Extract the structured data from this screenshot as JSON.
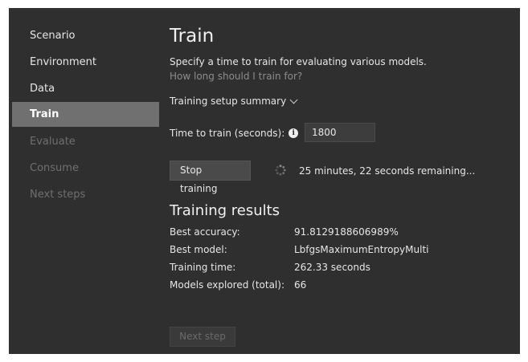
{
  "sidebar": {
    "items": [
      {
        "label": "Scenario",
        "state": "normal"
      },
      {
        "label": "Environment",
        "state": "normal"
      },
      {
        "label": "Data",
        "state": "normal"
      },
      {
        "label": "Train",
        "state": "selected"
      },
      {
        "label": "Evaluate",
        "state": "disabled"
      },
      {
        "label": "Consume",
        "state": "disabled"
      },
      {
        "label": "Next steps",
        "state": "disabled"
      }
    ]
  },
  "main": {
    "title": "Train",
    "description": "Specify a time to train for evaluating various models.",
    "help_link": "How long should I train for?",
    "summary_toggle": "Training setup summary",
    "time_to_train_label": "Time to train (seconds):",
    "time_to_train_value": "1800",
    "stop_button": "Stop training",
    "remaining_text": "25 minutes, 22 seconds remaining...",
    "results_title": "Training results",
    "results": [
      {
        "label": "Best accuracy:",
        "value": "91.8129188606989%"
      },
      {
        "label": "Best model:",
        "value": "LbfgsMaximumEntropyMulti"
      },
      {
        "label": "Training time:",
        "value": "262.33 seconds"
      },
      {
        "label": "Models explored (total):",
        "value": "66"
      }
    ],
    "next_button": "Next step"
  },
  "colors": {
    "background": "#2f2f2f",
    "selected_nav": "#707070",
    "disabled_text": "#6f6f6f",
    "link_text": "#8c8c8c"
  },
  "icons": {
    "info": "info-icon",
    "spinner": "spinner-icon",
    "summary_chevron": "chevron-down-icon"
  }
}
